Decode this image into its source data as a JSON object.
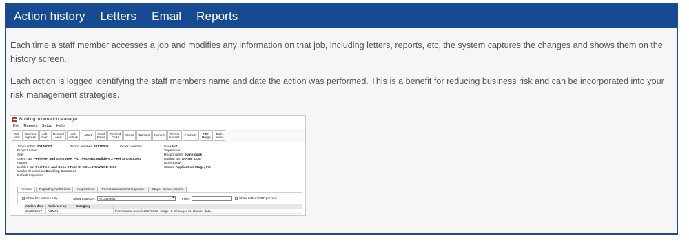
{
  "tabs": [
    {
      "label": "Action history"
    },
    {
      "label": "Letters"
    },
    {
      "label": "Email"
    },
    {
      "label": "Reports"
    }
  ],
  "paragraphs": [
    "Each time a staff member accesses a job and modifies any information on that job, including letters, reports, etc, the system captures the changes and shows them on the history screen.",
    "Each action is logged identifying the staff members name and date the action was performed. This is a benefit for reducing business risk and can be incorporated into your risk management strategies."
  ],
  "screenshot": {
    "window_title": "Building Information Manager",
    "menu": [
      "File",
      "Reports",
      "Setup",
      "Help"
    ],
    "toolbar": [
      "Job\nnew",
      "Job new\nexpress",
      "Job\nopen",
      "Remind\nAlert",
      "Job\ndetails",
      "Letters",
      "Send\nEmail",
      "Remind\nCerts",
      "Notes",
      "Remind",
      "Invoice",
      "Permit\nAssess",
      "Contacts",
      "PDF\nMerge",
      "Bulk\nemail"
    ],
    "info": {
      "job_number_label": "Job number:",
      "job_number": "20170002",
      "permit_number_label": "Permit number:",
      "permit_number": "20170002",
      "order_number_label": "Order number:",
      "user_ref_label": "User Ref:",
      "project_name_label": "Project name:",
      "supervisor_label": "Supervisor:",
      "site_label": "Site:",
      "responsible_label": "Responsible:",
      "responsible": "diane cook",
      "client_label": "Client:",
      "client": "Ian Peel Peel and Sons  NRK P/L T/AS NRK Builders  2  Peel St  COLLING",
      "issuing_bs_label": "Issuing BS:",
      "issuing_bs": "DIANE 1234",
      "owner_label": "Owner:",
      "municipality_label": "Municipality:",
      "builder_label": "Builder:",
      "builder": "Ian Peel Peel and Sons  2  Peel St  COLLINGWOOD 3066",
      "status_label": "Status:",
      "status": "Application Stage, 0%",
      "works_description_label": "Works description:",
      "works_description": "Dwelling Extension",
      "default_inspector_label": "Default Inspector:"
    },
    "subtabs": [
      "Actions",
      "Reporting Authorities",
      "Inspections",
      "Permit assessment response",
      "Stage, Builder, Works"
    ],
    "filters": {
      "show_key_actions": "Show key actions only",
      "show_category_label": "Show Category:",
      "show_category_value": "All Category",
      "filter_label": "Filter:",
      "show_letter_pdf": "Show Letter / PDF preview"
    },
    "grid": {
      "columns": [
        "Action date",
        "Actioned by",
        "Category",
        ""
      ],
      "rows": [
        [
          "31/08/2017",
          "ADMIN",
          "",
          "Permit data saved: 20170002. Stage: 1. Changes to: Builder data."
        ]
      ]
    }
  }
}
